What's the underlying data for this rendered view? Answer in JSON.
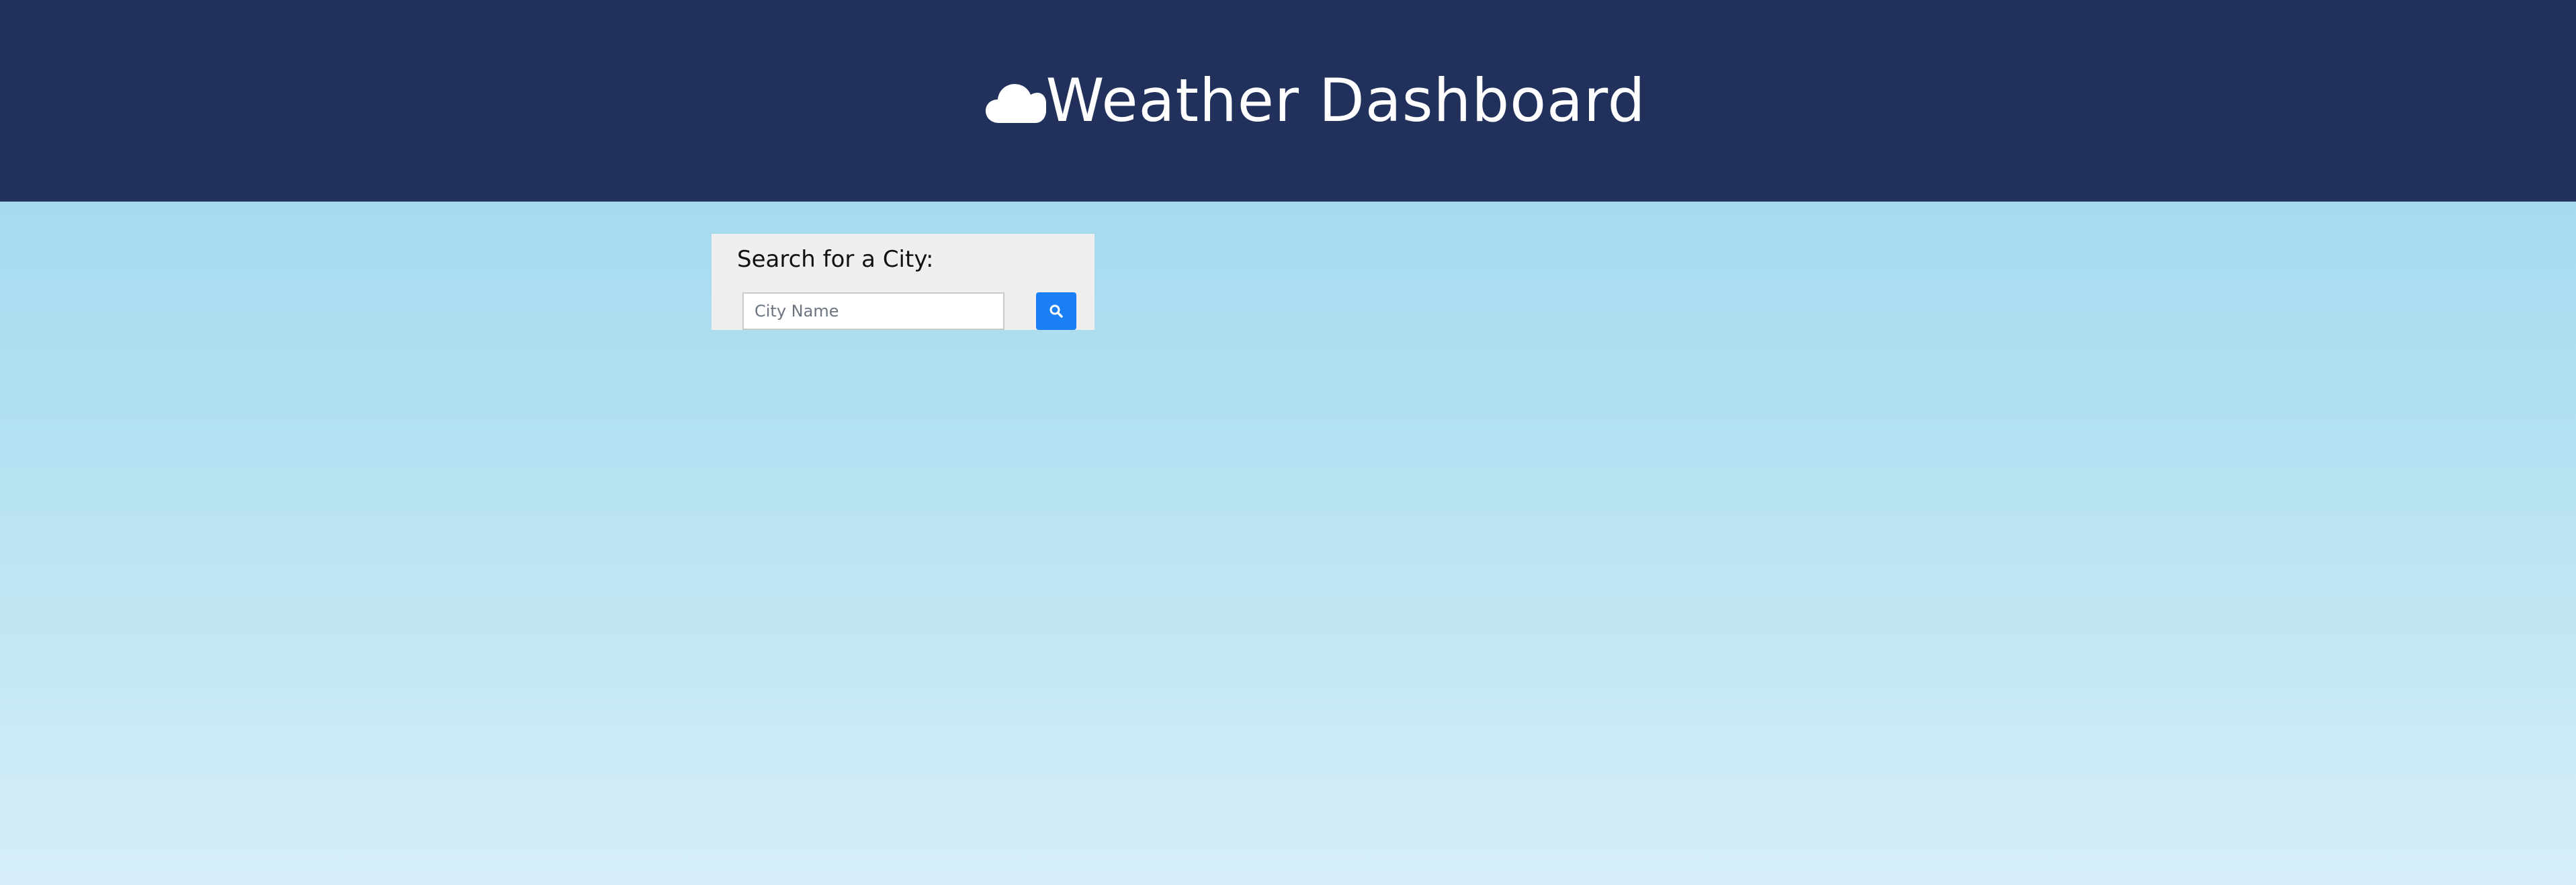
{
  "header": {
    "title": "Weather Dashboard",
    "icon": "cloud-icon",
    "background": "#21315c"
  },
  "search": {
    "heading": "Search for a City:",
    "placeholder": "City Name",
    "value": "",
    "button_icon": "search-icon",
    "button_color": "#1a7ff4"
  }
}
